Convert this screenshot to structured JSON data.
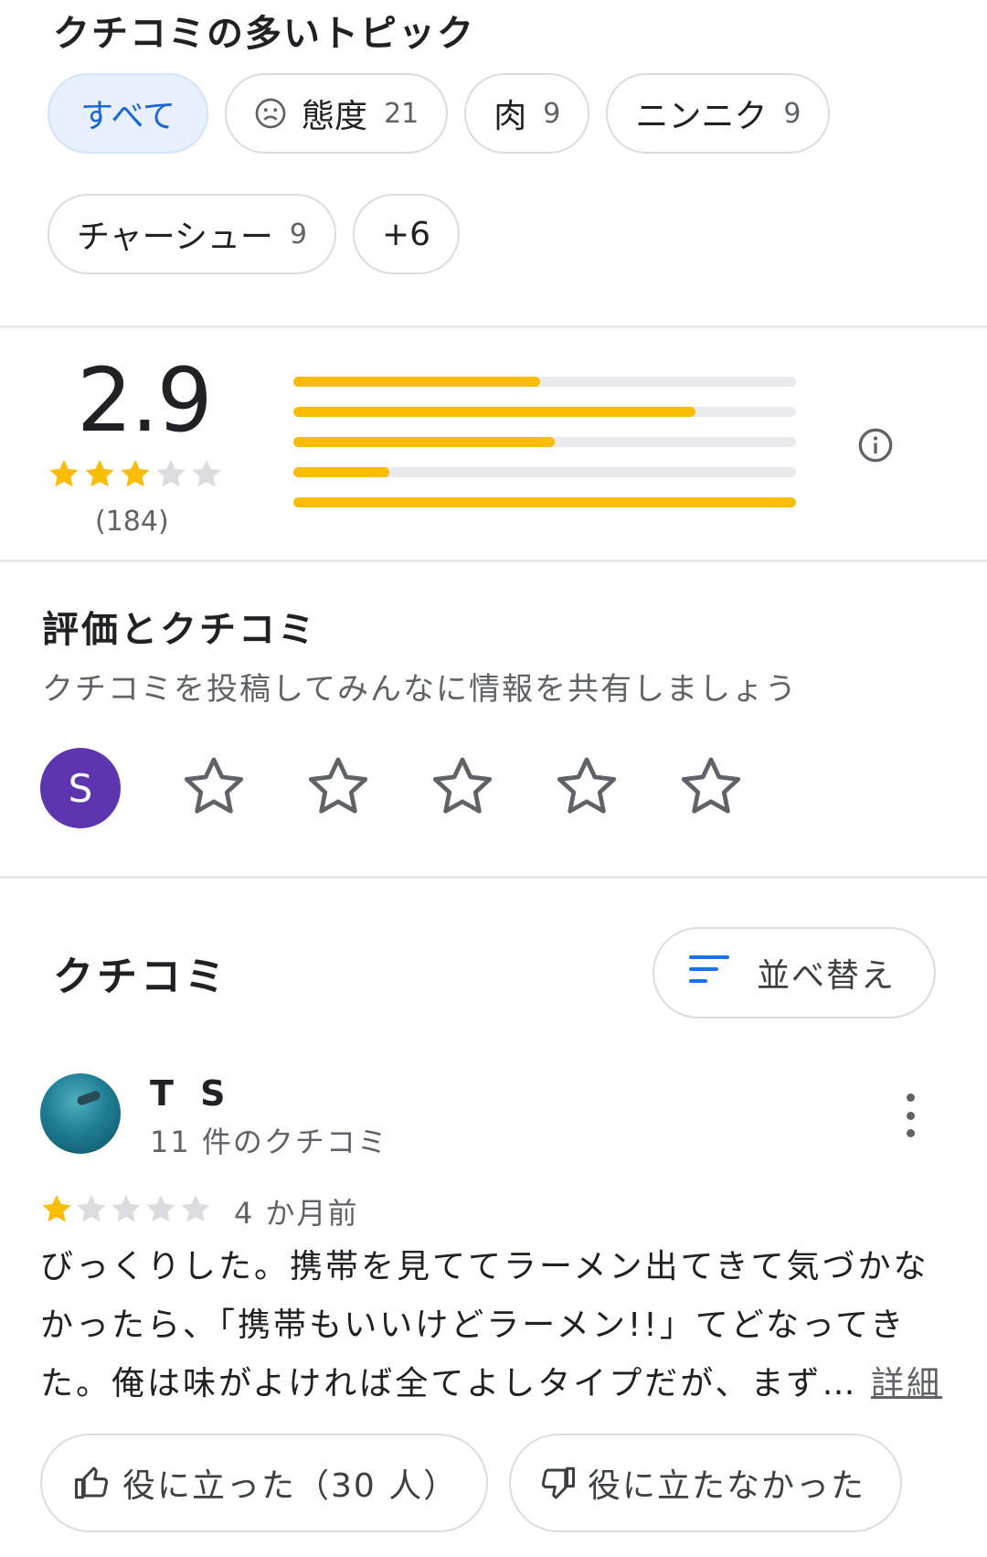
{
  "topics": {
    "title": "クチコミの多いトピック",
    "chips": [
      {
        "label": "すべて",
        "count": "",
        "active": true
      },
      {
        "label": "態度",
        "count": "21",
        "icon": "sad-face-icon"
      },
      {
        "label": "肉",
        "count": "9"
      },
      {
        "label": "ニンニク",
        "count": "9"
      },
      {
        "label": "チャーシュー",
        "count": "9"
      },
      {
        "label": "+6",
        "count": ""
      }
    ]
  },
  "summary": {
    "average": "2.9",
    "stars_filled": 3,
    "stars_total": 5,
    "count": "(184)",
    "distribution_fractions": [
      0.49,
      0.8,
      0.52,
      0.19,
      1.0
    ],
    "info_icon": "info-icon"
  },
  "write_review": {
    "heading": "評価とクチコミ",
    "prompt": "クチコミを投稿してみんなに情報を共有しましょう",
    "user_initial": "S"
  },
  "reviews": {
    "title": "クチコミ",
    "sort_label": "並べ替え",
    "items": [
      {
        "author": "T S",
        "meta": "11 件のクチコミ",
        "stars": 1,
        "time": "4 か月前",
        "text": "びっくりした。携帯を見ててラーメン出てきて気づかなかったら、「携帯もいいけどラーメン!!」てどなってきた。俺は味がよければ全てよしタイプだが、まず…",
        "more_label": "詳細",
        "helpful_label": "役に立った（30 人）",
        "not_helpful_label": "役に立たなかった"
      }
    ]
  },
  "colors": {
    "star": "#fbbc04",
    "accent_blue": "#1967d2",
    "avatar_purple": "#5e35b1"
  }
}
